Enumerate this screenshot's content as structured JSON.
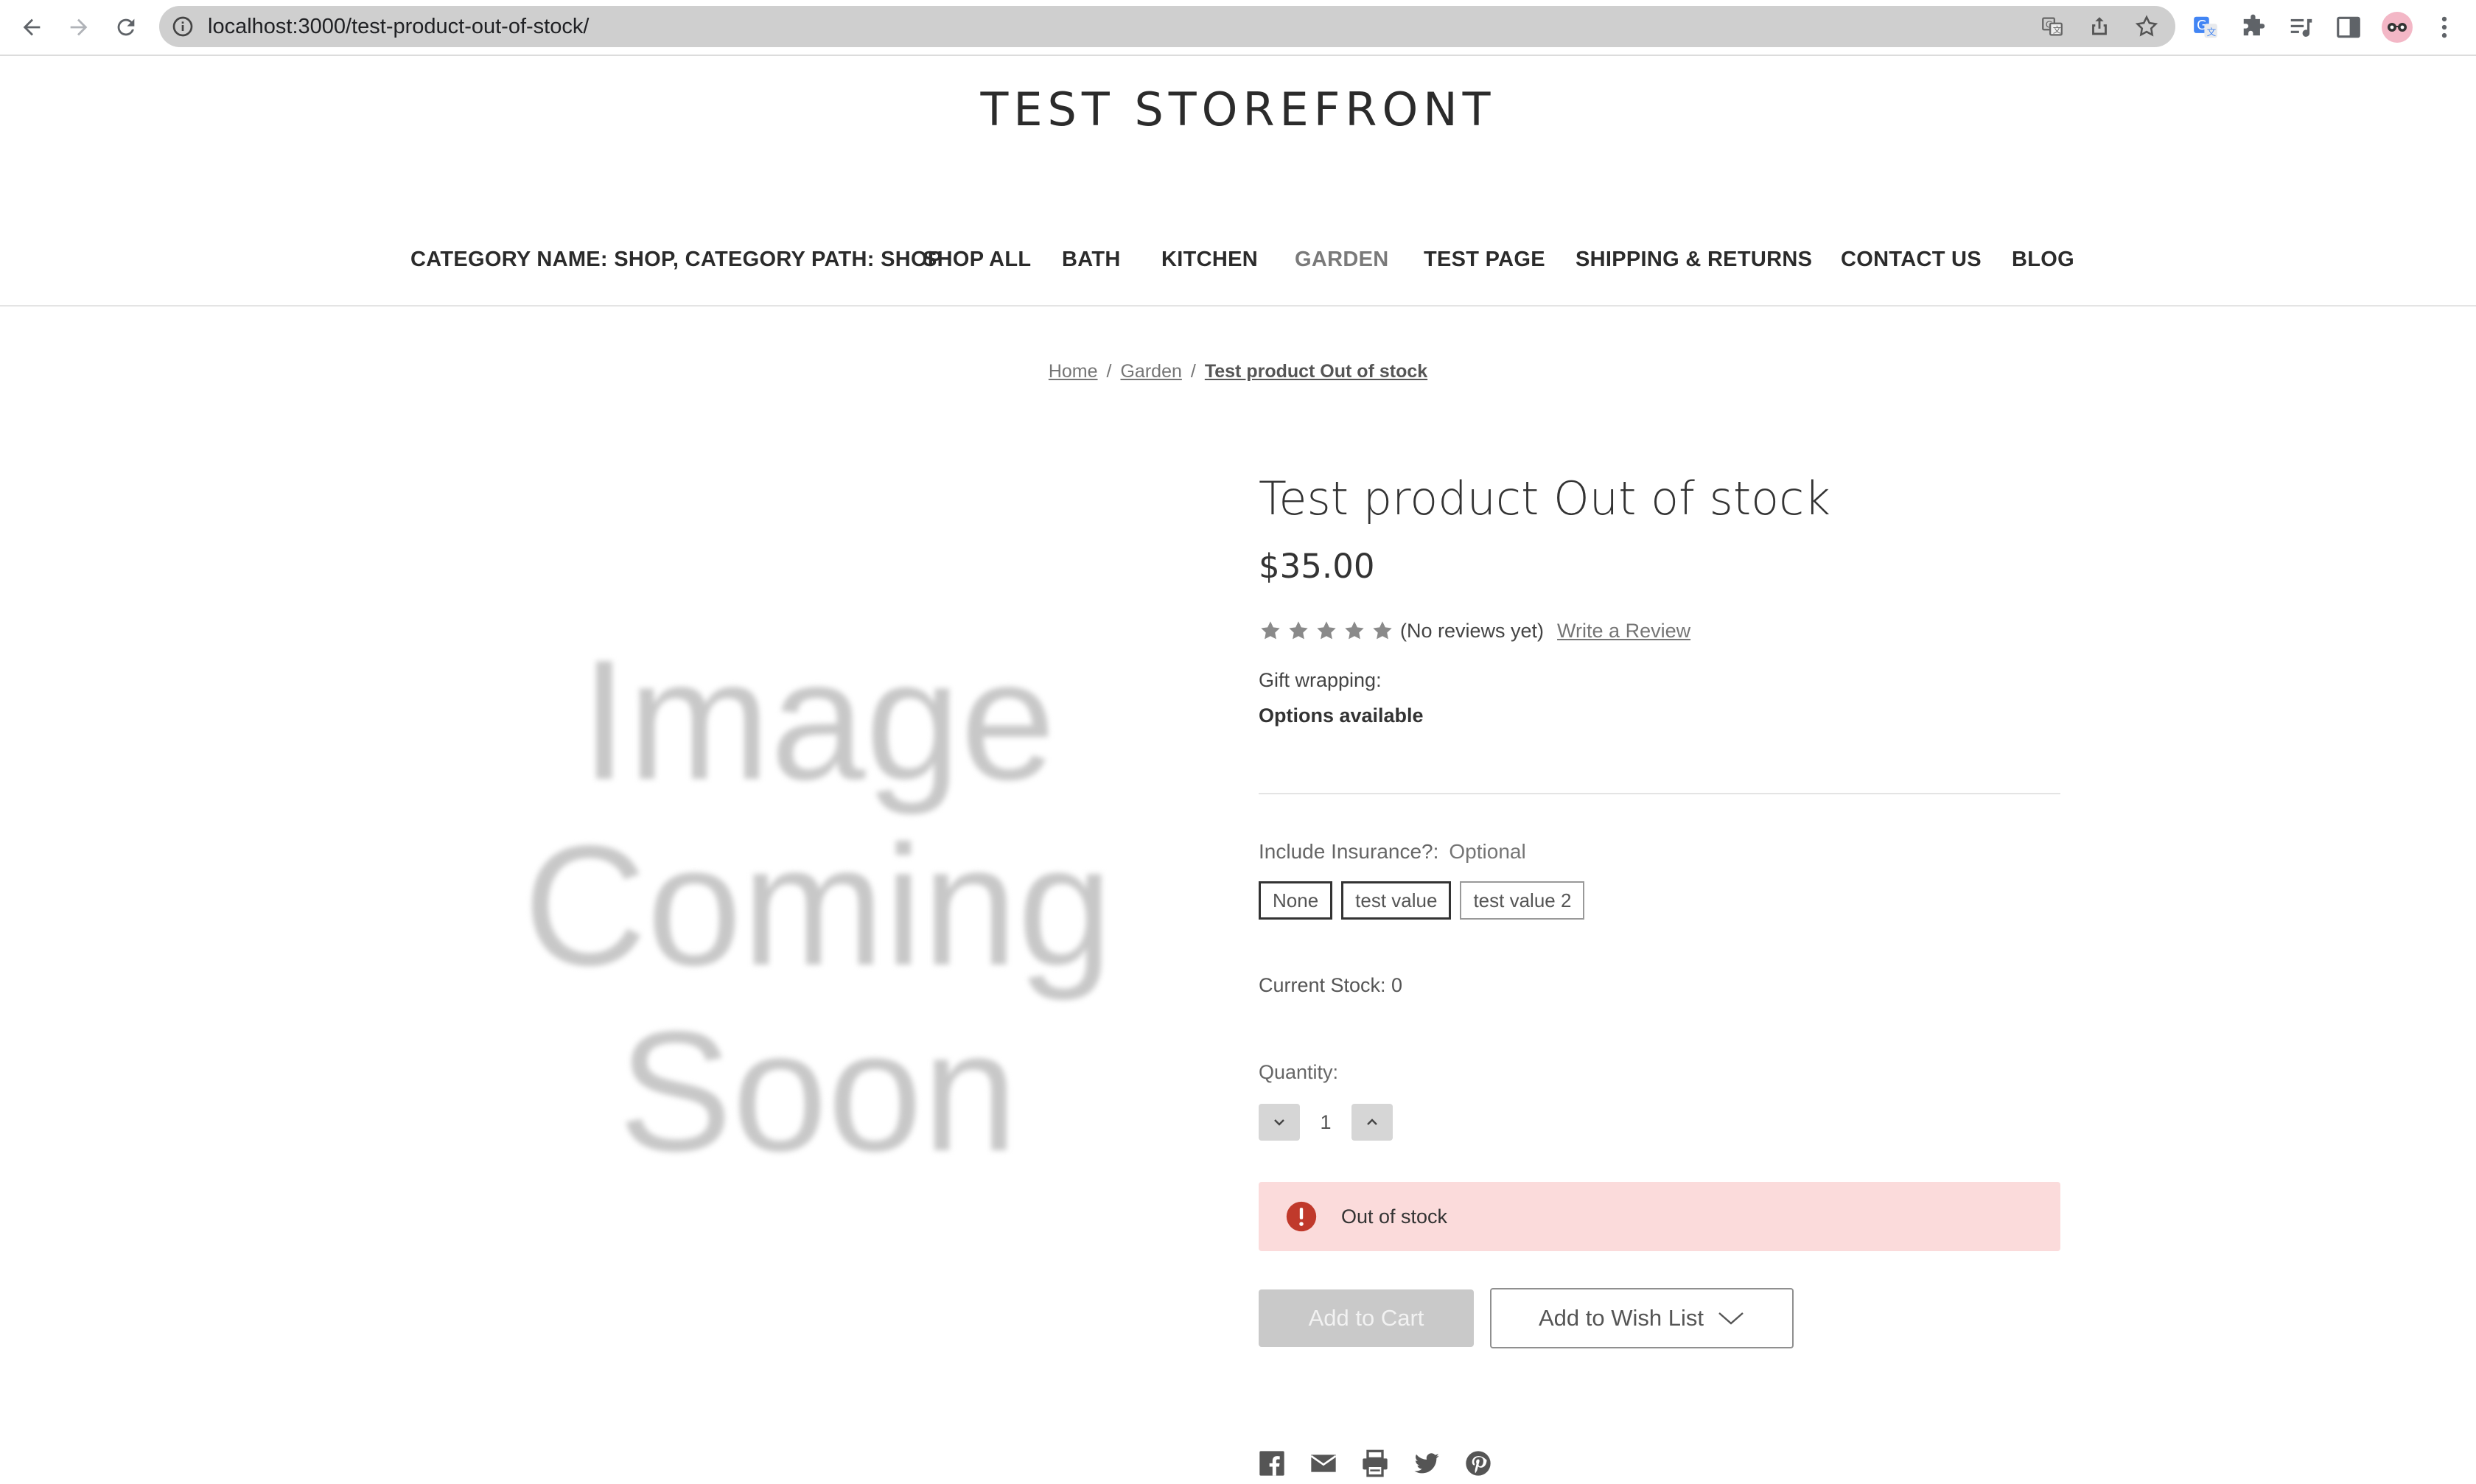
{
  "browser": {
    "url": "localhost:3000/test-product-out-of-stock/"
  },
  "store": {
    "title": "TEST STOREFRONT"
  },
  "nav": {
    "items": [
      "CATEGORY NAME: SHOP, CATEGORY PATH: SHOP",
      "SHOP ALL",
      "BATH",
      "KITCHEN",
      "GARDEN",
      "TEST PAGE",
      "SHIPPING & RETURNS",
      "CONTACT US",
      "BLOG"
    ],
    "active": "GARDEN"
  },
  "breadcrumb": {
    "items": [
      "Home",
      "Garden",
      "Test product Out of stock"
    ],
    "separator": "/"
  },
  "image": {
    "placeholder_lines": [
      "Image",
      "Coming",
      "Soon"
    ]
  },
  "product": {
    "title": "Test product Out of stock",
    "price": "$35.00",
    "rating": {
      "stars": 5,
      "filled": 0,
      "reviews_text": "(No reviews yet)",
      "write_review": "Write a Review"
    },
    "gift_wrapping_label": "Gift wrapping:",
    "gift_wrapping_value": "Options available",
    "insurance": {
      "label": "Include Insurance?:",
      "optional": "Optional",
      "options": [
        "None",
        "test value",
        "test value 2"
      ]
    },
    "current_stock": "Current Stock: 0",
    "quantity_label": "Quantity:",
    "quantity": "1",
    "alert": "Out of stock",
    "add_to_cart": "Add to Cart",
    "add_to_wishlist": "Add to Wish List"
  },
  "share": {
    "icons": [
      "facebook-icon",
      "email-icon",
      "print-icon",
      "twitter-icon",
      "pinterest-icon"
    ]
  },
  "colors": {
    "alert_bg": "#fbdbdb",
    "alert_icon": "#c0392b",
    "disabled_button": "#c9c9c9"
  }
}
